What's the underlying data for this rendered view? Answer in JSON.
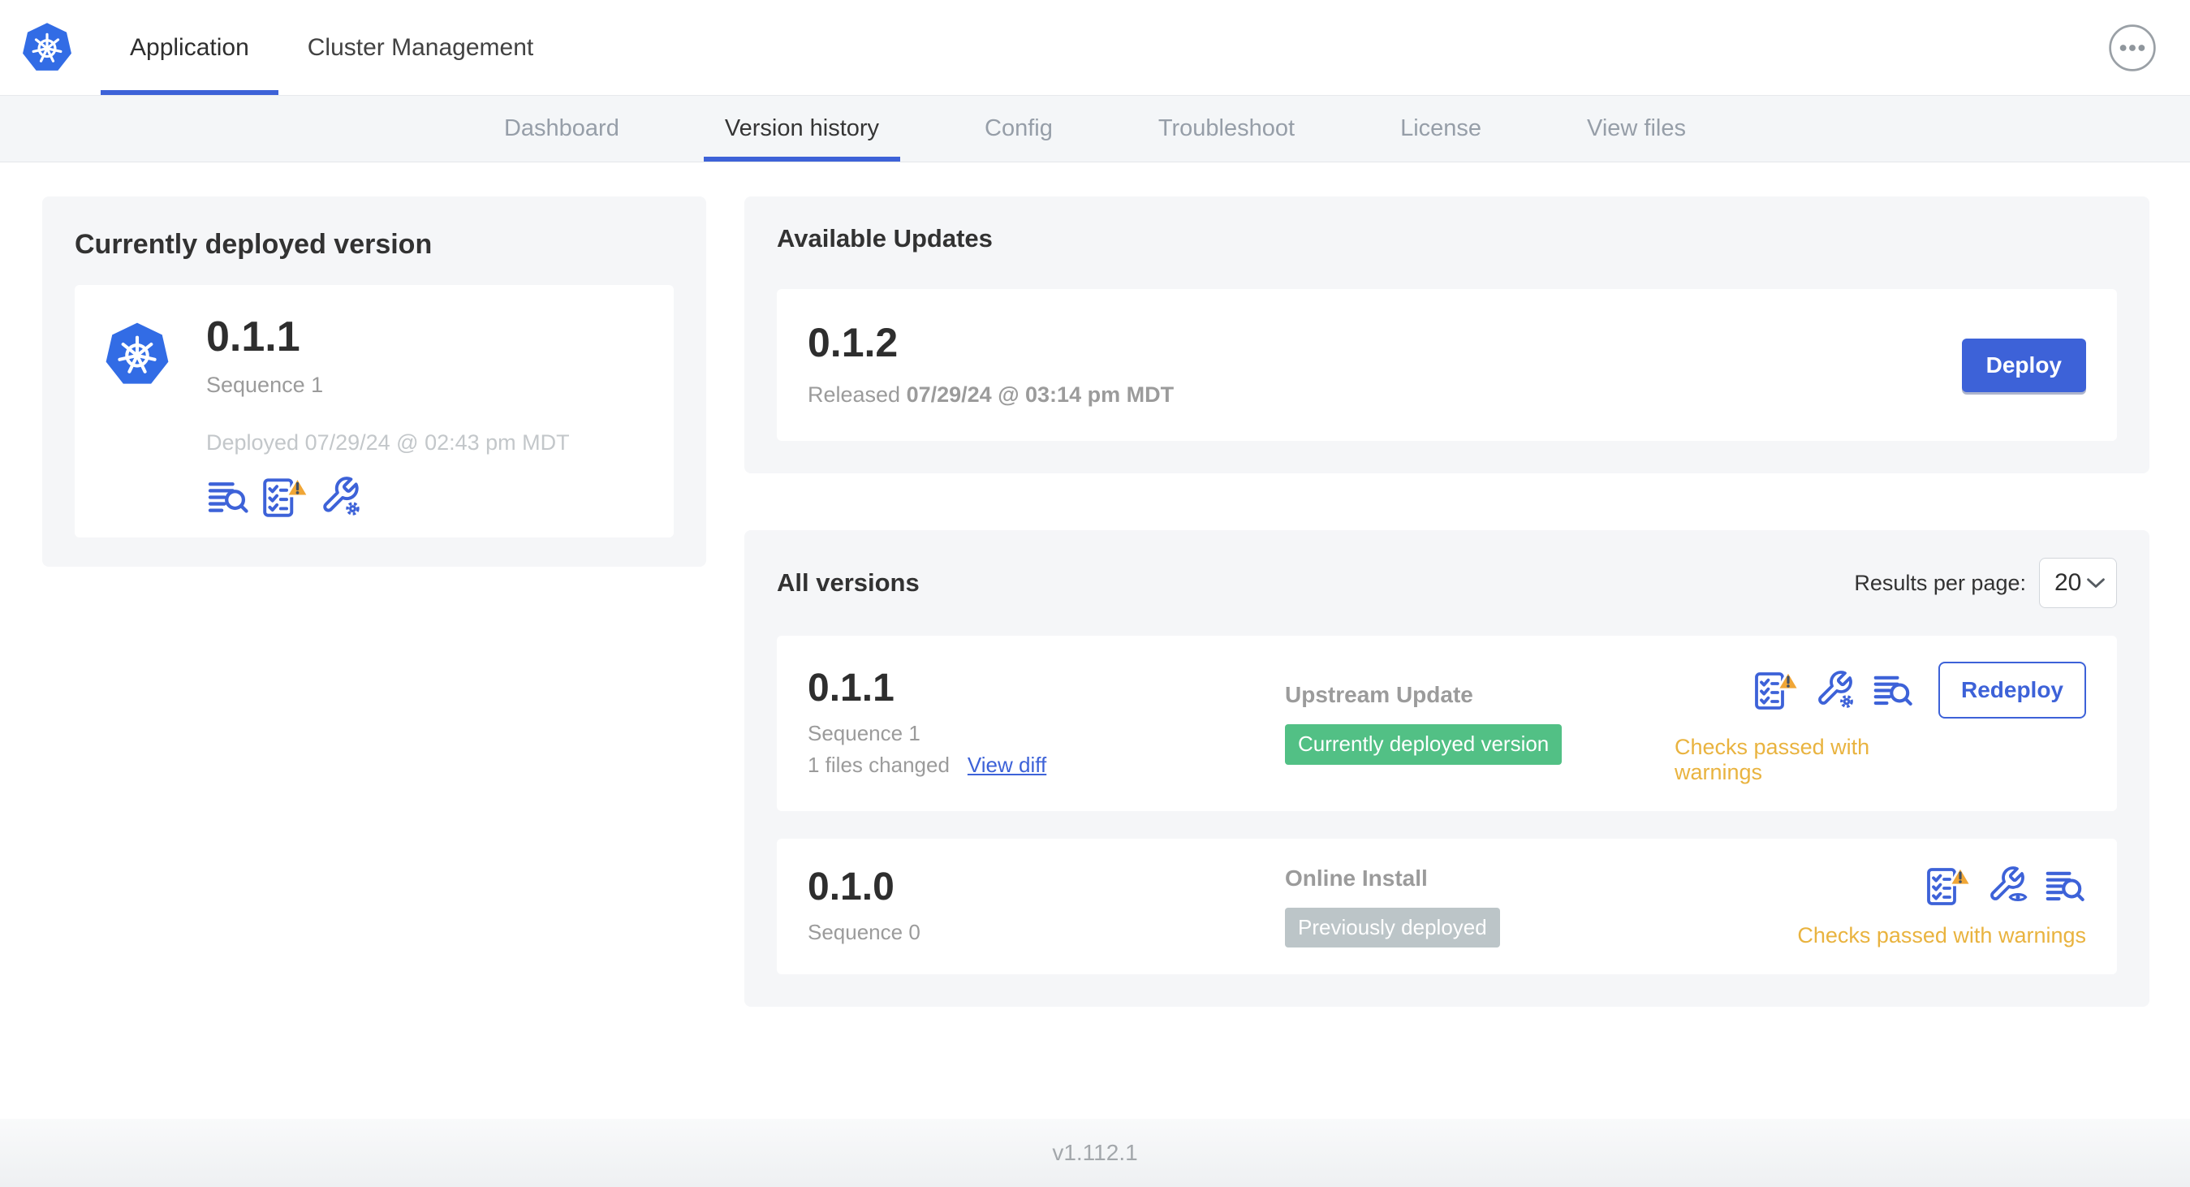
{
  "header": {
    "tabs": [
      {
        "label": "Application",
        "active": true
      },
      {
        "label": "Cluster Management",
        "active": false
      }
    ]
  },
  "subnav": {
    "tabs": [
      {
        "label": "Dashboard",
        "active": false
      },
      {
        "label": "Version history",
        "active": true
      },
      {
        "label": "Config",
        "active": false
      },
      {
        "label": "Troubleshoot",
        "active": false
      },
      {
        "label": "License",
        "active": false
      },
      {
        "label": "View files",
        "active": false
      }
    ]
  },
  "deployed_card": {
    "title": "Currently deployed version",
    "version": "0.1.1",
    "sequence": "Sequence 1",
    "deployed_at": "Deployed 07/29/24 @ 02:43 pm MDT"
  },
  "available_updates": {
    "title": "Available Updates",
    "version": "0.1.2",
    "released_prefix": "Released",
    "released_date": "07/29/24 @ 03:14 pm MDT",
    "deploy_label": "Deploy"
  },
  "all_versions": {
    "title": "All versions",
    "results_per_page_label": "Results per page:",
    "results_per_page_value": "20",
    "rows": [
      {
        "version": "0.1.1",
        "sequence": "Sequence 1",
        "files_changed": "1 files changed",
        "view_diff_label": "View diff",
        "source": "Upstream Update",
        "badge_label": "Currently deployed version",
        "badge_style": "green",
        "action_label": "Redeploy",
        "status": "Checks passed with warnings"
      },
      {
        "version": "0.1.0",
        "sequence": "Sequence 0",
        "source": "Online Install",
        "badge_label": "Previously deployed",
        "badge_style": "gray",
        "status": "Checks passed with warnings"
      }
    ]
  },
  "footer": {
    "app_version": "v1.112.1"
  },
  "icons": {
    "app_logo": "kubernetes-logo-icon",
    "overflow": "ellipsis-menu-icon",
    "logs": "deploy-logs-icon",
    "preflight_warning": "preflight-checklist-warning-icon",
    "edit_config": "wrench-gear-config-icon",
    "view_config": "wrench-eye-config-icon",
    "select_chevron": "chevron-down-icon"
  },
  "colors": {
    "accent_blue": "#3d62d8",
    "kubernetes_blue": "#326ce5",
    "badge_green": "#52c085",
    "badge_gray": "#bcc5c8",
    "warning_text": "#e9b33f",
    "warning_triangle": "#f0a636",
    "card_background": "#f5f6f8"
  }
}
